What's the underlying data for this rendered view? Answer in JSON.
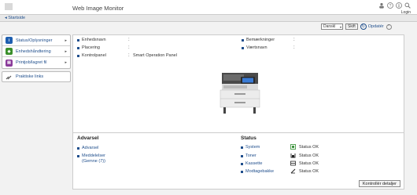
{
  "header": {
    "title": "Web Image Monitor",
    "login": "Login"
  },
  "breadcrumb": {
    "home": "Startside"
  },
  "toolbar": {
    "language": "Danskl",
    "switch_label": "Skift",
    "update_label": "Opdatér"
  },
  "sidebar": {
    "items": [
      {
        "label": "Status/Oplysninger",
        "icon": "info-icon",
        "color": "#1f5fb0"
      },
      {
        "label": "Enhedshåndtering",
        "icon": "device-icon",
        "color": "#3a8f2a"
      },
      {
        "label": "Printjob/lagret fil",
        "icon": "print-job-icon",
        "color": "#8a3a9a"
      }
    ],
    "links": {
      "label": "Praktiske links"
    }
  },
  "device_info": {
    "left": [
      {
        "label": "Enhedsnavn",
        "value": ""
      },
      {
        "label": "Placering",
        "value": ""
      },
      {
        "label": "Kontrolpanel",
        "value": "Smart Operation Panel"
      }
    ],
    "right": [
      {
        "label": "Bemærkninger",
        "value": ""
      },
      {
        "label": "Værtsnavn",
        "value": ""
      }
    ]
  },
  "alerts": {
    "title": "Advarsel",
    "items": [
      "Advarsel",
      "Meddelelser (Gemne (7))"
    ]
  },
  "status": {
    "title": "Status",
    "items": [
      {
        "label": "System",
        "value": "Status OK",
        "icon": "printer-status-icon"
      },
      {
        "label": "Toner",
        "value": "Status OK",
        "icon": "toner-icon"
      },
      {
        "label": "Kassette",
        "value": "Status OK",
        "icon": "tray-icon"
      },
      {
        "label": "Modtagebakke",
        "value": "Status OK",
        "icon": "output-tray-icon"
      }
    ]
  },
  "details_button": "Kontrollér detaljer"
}
